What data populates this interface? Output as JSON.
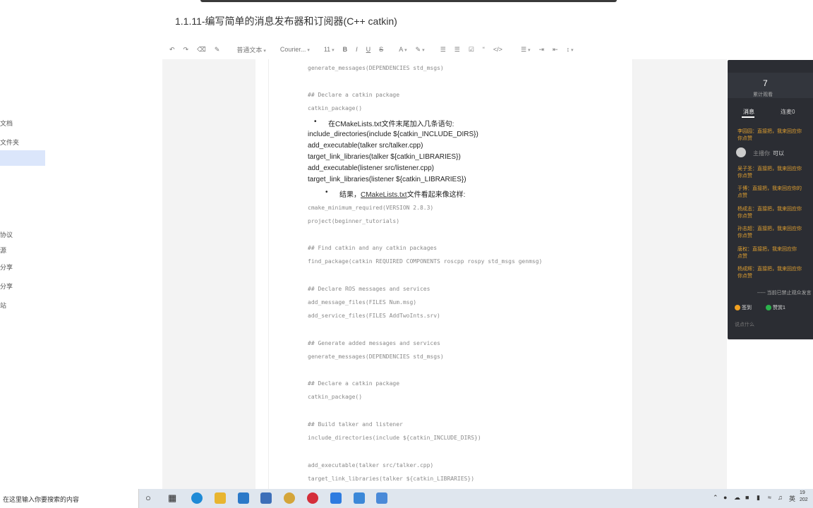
{
  "document": {
    "title": "1.1.11-编写简单的消息发布器和订阅器(C++ catkin)"
  },
  "sidebar": {
    "items": [
      "文档",
      "文件夹",
      "协议",
      "源",
      "分享",
      "分享",
      "站"
    ]
  },
  "toolbar": {
    "style": "普通文本",
    "font": "Courier...",
    "size": "11",
    "bold": "B",
    "italic": "I",
    "underline": "U",
    "strike": "S",
    "font_color": "A",
    "quote": "“",
    "code": "</>"
  },
  "content": {
    "lines": [
      {
        "kind": "code",
        "text": "generate_messages(DEPENDENCIES std_msgs)"
      },
      {
        "kind": "code",
        "text": "## Declare a catkin package"
      },
      {
        "kind": "code",
        "text": "catkin_package()"
      },
      {
        "kind": "bullet",
        "text": "在CMakeLists.txt文件末尾加入几条语句:"
      },
      {
        "kind": "text",
        "text": "include_directories(include ${catkin_INCLUDE_DIRS})"
      },
      {
        "kind": "text",
        "text": "add_executable(talker src/talker.cpp)"
      },
      {
        "kind": "text",
        "text": "target_link_libraries(talker ${catkin_LIBRARIES})"
      },
      {
        "kind": "text",
        "text": "add_executable(listener src/listener.cpp)"
      },
      {
        "kind": "text",
        "text": "target_link_libraries(listener ${catkin_LIBRARIES})"
      },
      {
        "kind": "bullet_link",
        "pre": "结果，",
        "link": "CMakeLists.txt",
        "post": "文件看起来像这样:"
      },
      {
        "kind": "code",
        "text": "cmake_minimum_required(VERSION 2.8.3)"
      },
      {
        "kind": "code",
        "text": "project(beginner_tutorials)"
      },
      {
        "kind": "code",
        "text": "## Find catkin and any catkin packages"
      },
      {
        "kind": "code",
        "text": "find_package(catkin REQUIRED COMPONENTS roscpp rospy std_msgs genmsg)"
      },
      {
        "kind": "code",
        "text": "## Declare ROS messages and services"
      },
      {
        "kind": "code",
        "text": "add_message_files(FILES Num.msg)"
      },
      {
        "kind": "code",
        "text": "add_service_files(FILES AddTwoInts.srv)"
      },
      {
        "kind": "code",
        "text": "## Generate added messages and services"
      },
      {
        "kind": "code",
        "text": "generate_messages(DEPENDENCIES std_msgs)"
      },
      {
        "kind": "code",
        "text": "## Declare a catkin package"
      },
      {
        "kind": "code",
        "text": "catkin_package()"
      },
      {
        "kind": "code",
        "text": "## Build talker and listener"
      },
      {
        "kind": "code",
        "text": "include_directories(include ${catkin_INCLUDE_DIRS})"
      },
      {
        "kind": "code",
        "text": "add_executable(talker src/talker.cpp)"
      },
      {
        "kind": "code",
        "text": "target_link_libraries(talker ${catkin_LIBRARIES})"
      }
    ]
  },
  "chat": {
    "stat_value": "7",
    "stat_label": "累计观看",
    "tab_messages": "消息",
    "tab_connect": "连麦0",
    "messages": [
      "李园园：直接把，我来回应你",
      "你点赞",
      "吴子圣：直接把，我来回应你",
      "你点赞",
      "于博：直接把，我来回应你的",
      "点赞",
      "杨成志：直接把，我来回应你",
      "你点赞",
      "孙志超：直接把，我来回应你",
      "你点赞",
      "唐权：直接把，我来回应你",
      "点赞",
      "杨成辉：直接把，我来回应你",
      "你点赞"
    ],
    "system_name": "主播你",
    "system_text": "可以",
    "more_text": "----- 当前已禁止观众发言",
    "sign_in": "签到",
    "like": "赞赏1",
    "input_placeholder": "说点什么"
  },
  "taskbar": {
    "search_placeholder": "在这里输入你要搜索的内容",
    "lang": "英",
    "clock": "19",
    "date": "202"
  }
}
